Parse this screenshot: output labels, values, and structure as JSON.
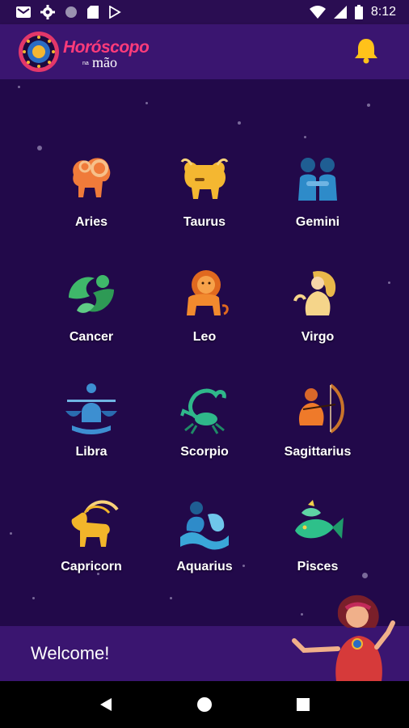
{
  "status_bar": {
    "time": "8:12",
    "icons_left": [
      "gmail-icon",
      "settings-icon",
      "circle-icon",
      "sd-card-icon",
      "play-store-icon"
    ],
    "icons_right": [
      "wifi-icon",
      "signal-icon",
      "battery-icon"
    ]
  },
  "app_bar": {
    "logo_main": "Horóscopo",
    "logo_sub_small": "na",
    "logo_sub": "mão",
    "notification_icon": "bell-icon",
    "accent_color": "#ffc21a",
    "brand_color": "#ff3b7a"
  },
  "signs": [
    {
      "label": "Aries",
      "icon": "ram-icon",
      "color": "#f07b3a"
    },
    {
      "label": "Taurus",
      "icon": "bull-icon",
      "color": "#f4b731"
    },
    {
      "label": "Gemini",
      "icon": "twins-icon",
      "color": "#2e8bc9"
    },
    {
      "label": "Cancer",
      "icon": "crab-icon",
      "color": "#3fb86a"
    },
    {
      "label": "Leo",
      "icon": "lion-icon",
      "color": "#f28a2e"
    },
    {
      "label": "Virgo",
      "icon": "maiden-icon",
      "color": "#f5d58a"
    },
    {
      "label": "Libra",
      "icon": "scales-icon",
      "color": "#3d8fd1"
    },
    {
      "label": "Scorpio",
      "icon": "scorpion-icon",
      "color": "#2fb88a"
    },
    {
      "label": "Sagittarius",
      "icon": "archer-icon",
      "color": "#ef7a2a"
    },
    {
      "label": "Capricorn",
      "icon": "goat-icon",
      "color": "#f2b52a"
    },
    {
      "label": "Aquarius",
      "icon": "water-bearer-icon",
      "color": "#3aa7d8"
    },
    {
      "label": "Pisces",
      "icon": "fish-icon",
      "color": "#2ec08a"
    }
  ],
  "welcome": {
    "text": "Welcome!",
    "illustration": "fortune-teller-icon"
  },
  "nav_bar": {
    "back": "back-icon",
    "home": "home-icon",
    "recents": "recents-icon"
  }
}
